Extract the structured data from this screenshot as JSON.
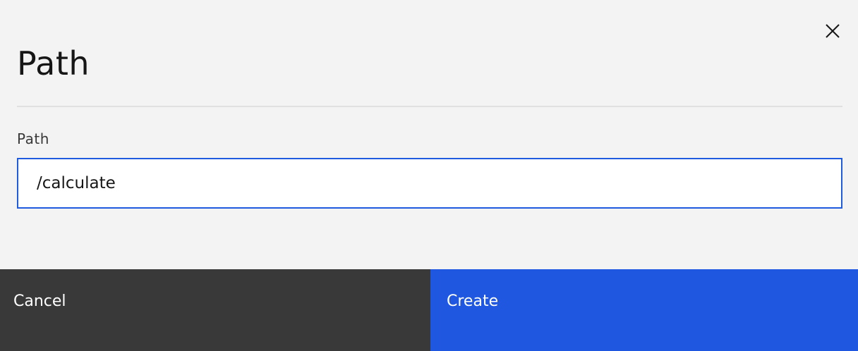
{
  "modal": {
    "title": "Path",
    "close_icon": "close-icon"
  },
  "form": {
    "path_label": "Path",
    "path_value": "/calculate"
  },
  "footer": {
    "cancel_label": "Cancel",
    "create_label": "Create"
  },
  "colors": {
    "background": "#f3f3f3",
    "input_border_focus": "#1f5bdf",
    "cancel_button": "#393939",
    "primary_button": "#1f57e0"
  }
}
